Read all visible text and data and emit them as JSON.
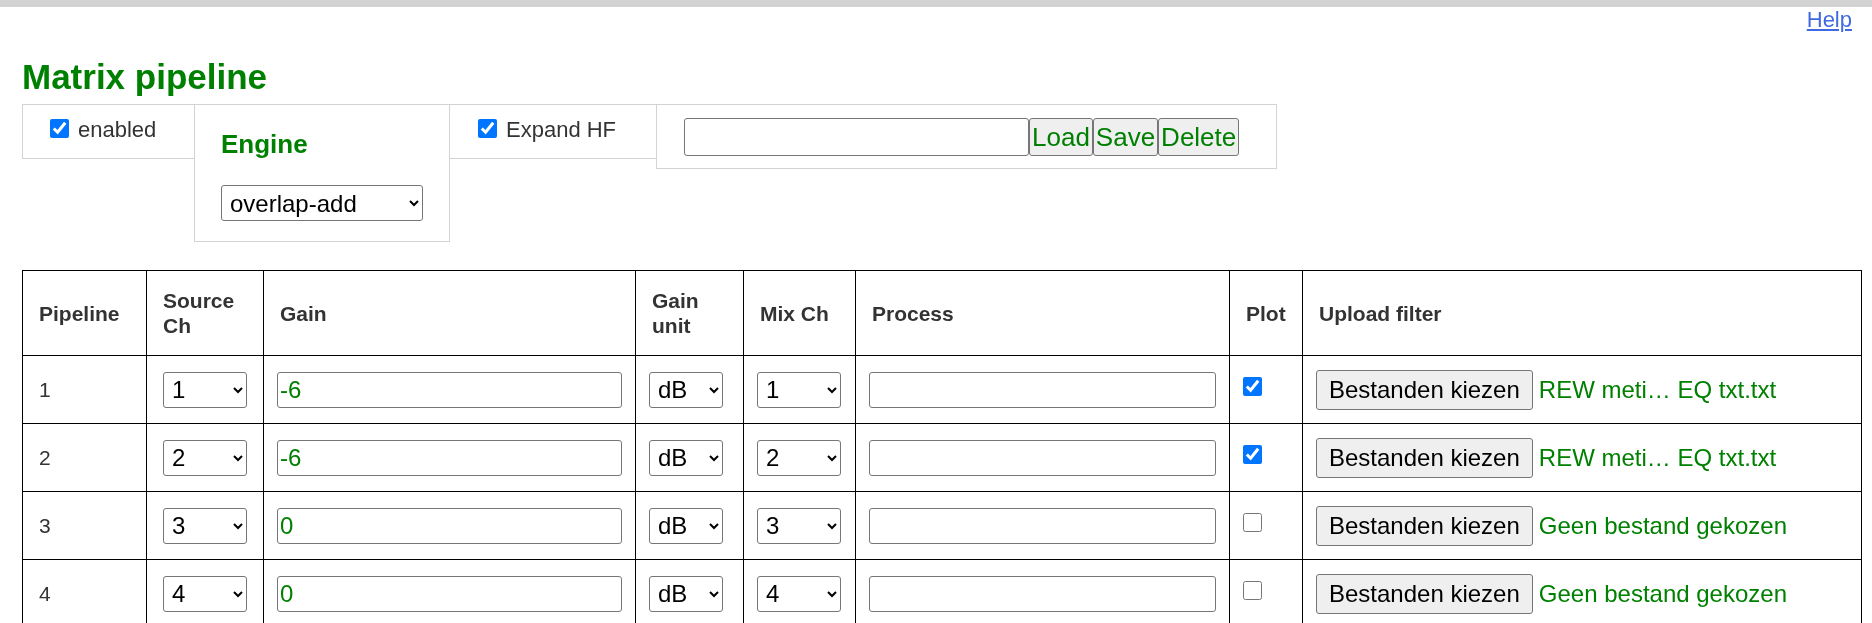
{
  "help_link": "Help",
  "title": "Matrix pipeline",
  "controls": {
    "enabled": {
      "label": "enabled",
      "checked": true
    },
    "engine": {
      "label": "Engine",
      "value": "overlap-add"
    },
    "expand_hf": {
      "label": "Expand HF",
      "checked": true
    },
    "preset": {
      "buttons": [
        "Load",
        "Save",
        "Delete"
      ]
    }
  },
  "table": {
    "columns": [
      "Pipeline",
      "Source Ch",
      "Gain",
      "Gain unit",
      "Mix Ch",
      "Process",
      "Plot",
      "Upload filter"
    ],
    "rows": [
      {
        "pipeline": "1",
        "source_ch": "1",
        "gain": "-6",
        "gain_unit": "dB",
        "mix_ch": "1",
        "plot": true,
        "upload_button": "Bestanden kiezen",
        "file": "REW meti… EQ txt.txt"
      },
      {
        "pipeline": "2",
        "source_ch": "2",
        "gain": "-6",
        "gain_unit": "dB",
        "mix_ch": "2",
        "plot": true,
        "upload_button": "Bestanden kiezen",
        "file": "REW meti… EQ txt.txt"
      },
      {
        "pipeline": "3",
        "source_ch": "3",
        "gain": "0",
        "gain_unit": "dB",
        "mix_ch": "3",
        "plot": false,
        "upload_button": "Bestanden kiezen",
        "file": "Geen bestand gekozen"
      },
      {
        "pipeline": "4",
        "source_ch": "4",
        "gain": "0",
        "gain_unit": "dB",
        "mix_ch": "4",
        "plot": false,
        "upload_button": "Bestanden kiezen",
        "file": "Geen bestand gekozen"
      }
    ]
  }
}
